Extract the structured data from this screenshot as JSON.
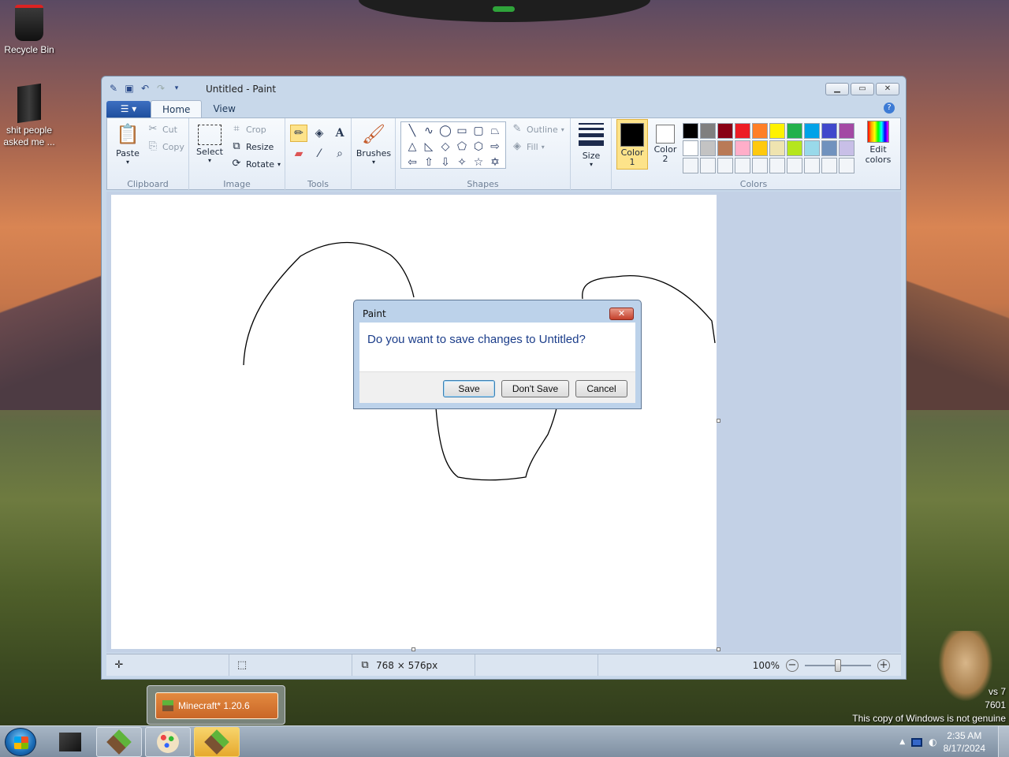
{
  "desktop": {
    "icons": [
      {
        "label": "Recycle Bin"
      },
      {
        "label": "shit people asked me ..."
      }
    ],
    "watermark": {
      "line1": "vs 7",
      "line2": "7601",
      "line3": "This copy of Windows is not genuine"
    }
  },
  "paint": {
    "title": "Untitled - Paint",
    "tabs": [
      "Home",
      "View"
    ],
    "clipboard": {
      "paste": "Paste",
      "cut": "Cut",
      "copy": "Copy",
      "label": "Clipboard"
    },
    "image": {
      "select": "Select",
      "crop": "Crop",
      "resize": "Resize",
      "rotate": "Rotate",
      "label": "Image"
    },
    "tools": {
      "label": "Tools"
    },
    "brushes": {
      "label": "Brushes"
    },
    "shapes": {
      "outline": "Outline",
      "fill": "Fill",
      "label": "Shapes"
    },
    "size": {
      "label": "Size"
    },
    "colors": {
      "color1": "Color 1",
      "color2": "Color 2",
      "edit": "Edit colors",
      "label": "Colors",
      "color1_value": "#000000",
      "color2_value": "#ffffff",
      "palette": [
        "#000000",
        "#7f7f7f",
        "#880015",
        "#ed1c24",
        "#ff7f27",
        "#fff200",
        "#22b14c",
        "#00a2e8",
        "#3f48cc",
        "#a349a4",
        "#ffffff",
        "#c3c3c3",
        "#b97a57",
        "#ffaec9",
        "#ffc90e",
        "#efe4b0",
        "#b5e61d",
        "#99d9ea",
        "#7092be",
        "#c8bfe7",
        "#f2f5f9",
        "#f2f5f9",
        "#f2f5f9",
        "#f2f5f9",
        "#f2f5f9",
        "#f2f5f9",
        "#f2f5f9",
        "#f2f5f9",
        "#f2f5f9",
        "#f2f5f9"
      ]
    },
    "status": {
      "dimensions": "768 × 576px",
      "zoom": "100%"
    }
  },
  "dialog": {
    "title": "Paint",
    "message": "Do you want to save changes to Untitled?",
    "save": "Save",
    "dont_save": "Don't Save",
    "cancel": "Cancel"
  },
  "taskbar": {
    "thumbnail_label": "Minecraft* 1.20.6",
    "time": "2:35 AM",
    "date": "8/17/2024"
  }
}
